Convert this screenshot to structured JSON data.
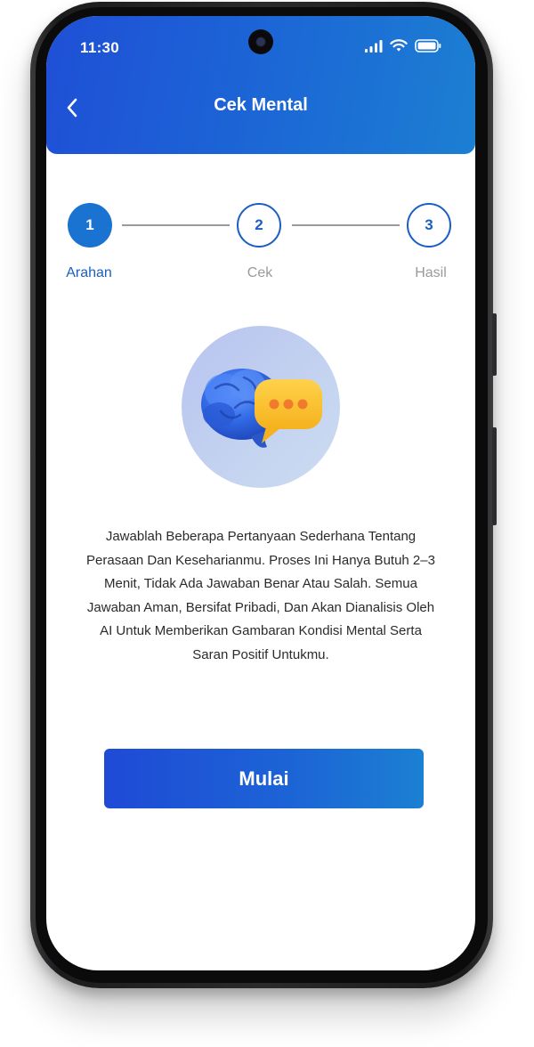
{
  "status_bar": {
    "time": "11:30"
  },
  "header": {
    "title": "Cek Mental"
  },
  "stepper": {
    "steps": [
      {
        "number": "1",
        "label": "Arahan",
        "state": "active"
      },
      {
        "number": "2",
        "label": "Cek",
        "state": "todo"
      },
      {
        "number": "3",
        "label": "Hasil",
        "state": "todo"
      }
    ]
  },
  "illustration": {
    "icon": "brain-chat-bubble-icon"
  },
  "description": "Jawablah Beberapa Pertanyaan Sederhana Tentang Perasaan Dan Keseharianmu. Proses Ini Hanya Butuh 2–3 Menit, Tidak Ada Jawaban Benar Atau Salah. Semua Jawaban Aman, Bersifat Pribadi, Dan Akan Dianalisis Oleh AI Untuk Memberikan Gambaran Kondisi Mental Serta Saran Positif Untukmu.",
  "start_button": {
    "label": "Mulai"
  },
  "colors": {
    "primary": "#1a73d1",
    "header_gradient_start": "#1f4fd6",
    "header_gradient_end": "#1c7fd2",
    "inactive": "#9a9a9a"
  }
}
